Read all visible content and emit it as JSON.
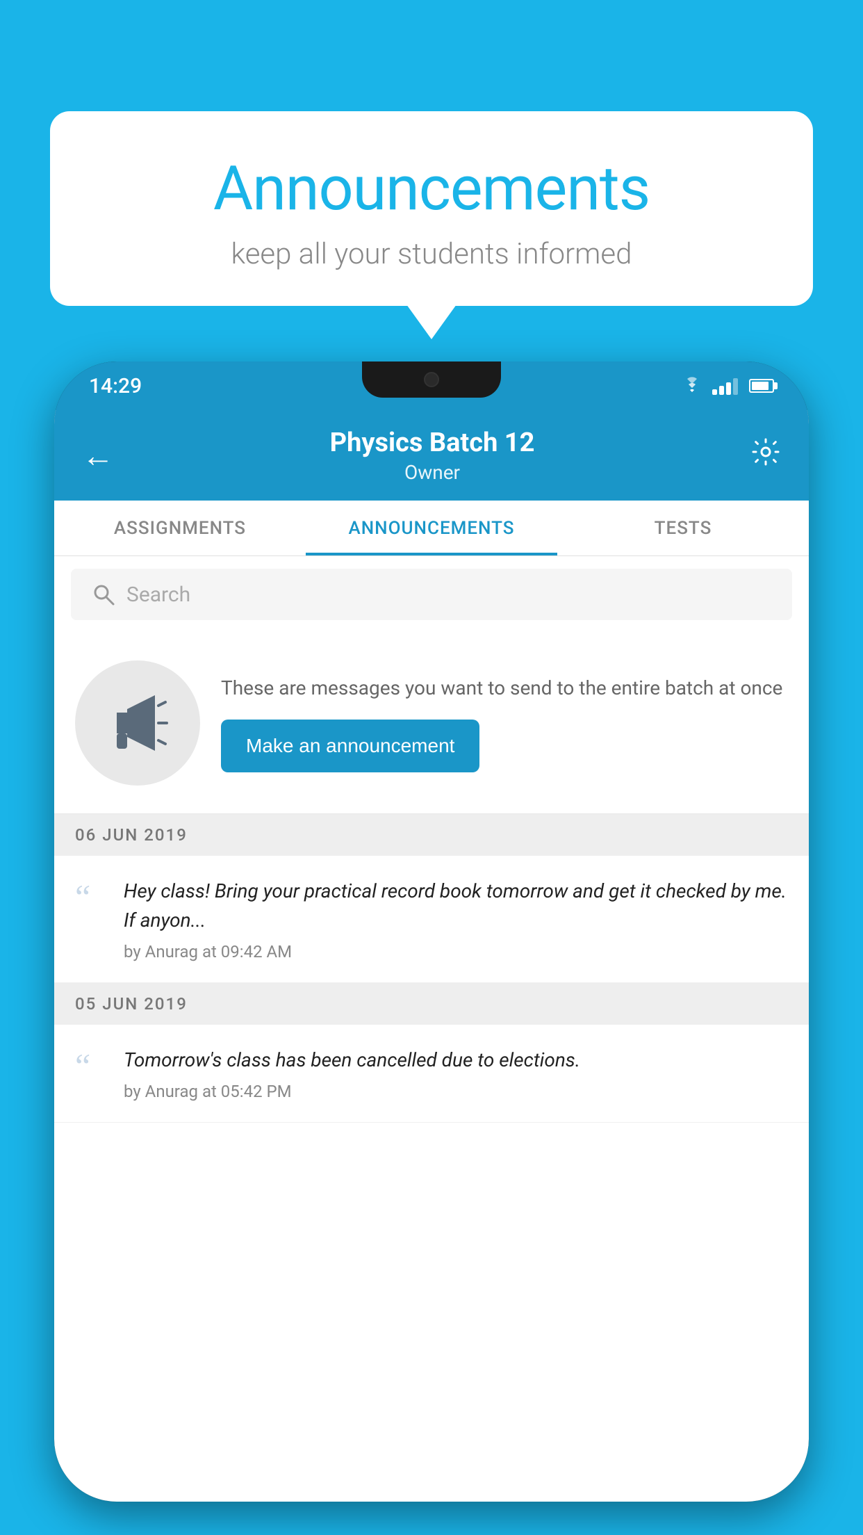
{
  "background": {
    "color": "#1ab4e8"
  },
  "speech_bubble": {
    "title": "Announcements",
    "subtitle": "keep all your students informed"
  },
  "phone": {
    "status_bar": {
      "time": "14:29"
    },
    "app_bar": {
      "title": "Physics Batch 12",
      "subtitle": "Owner",
      "back_label": "←",
      "settings_label": "⚙"
    },
    "tabs": [
      {
        "label": "ASSIGNMENTS",
        "active": false
      },
      {
        "label": "ANNOUNCEMENTS",
        "active": true
      },
      {
        "label": "TESTS",
        "active": false
      }
    ],
    "search": {
      "placeholder": "Search"
    },
    "promo": {
      "description": "These are messages you want to send to the entire batch at once",
      "button_label": "Make an announcement"
    },
    "announcements": [
      {
        "date": "06  JUN  2019",
        "text": "Hey class! Bring your practical record book tomorrow and get it checked by me. If anyon...",
        "meta": "by Anurag at 09:42 AM"
      },
      {
        "date": "05  JUN  2019",
        "text": "Tomorrow's class has been cancelled due to elections.",
        "meta": "by Anurag at 05:42 PM"
      }
    ]
  }
}
